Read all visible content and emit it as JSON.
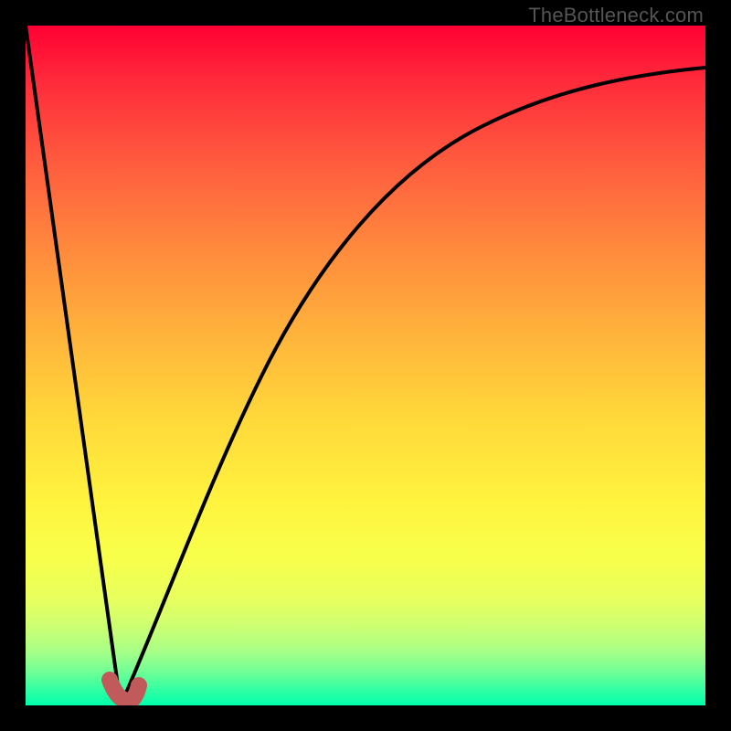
{
  "watermark": "TheBottleneck.com",
  "chart_data": {
    "type": "line",
    "title": "",
    "xlabel": "",
    "ylabel": "",
    "xlim": [
      0,
      100
    ],
    "ylim": [
      0,
      100
    ],
    "grid": false,
    "series": [
      {
        "name": "falling-segment",
        "x": [
          0,
          14
        ],
        "y": [
          100,
          0
        ]
      },
      {
        "name": "rising-curve",
        "x": [
          14,
          18,
          22,
          26,
          30,
          35,
          40,
          46,
          53,
          60,
          68,
          77,
          87,
          100
        ],
        "y": [
          0,
          12,
          23,
          33,
          42,
          52,
          60,
          67,
          74,
          79,
          84,
          88,
          91,
          94
        ]
      },
      {
        "name": "marker",
        "x": [
          12.5,
          13.5,
          14.5,
          15.3,
          16
        ],
        "y": [
          3.5,
          1.2,
          0.6,
          1.4,
          2.8
        ]
      }
    ],
    "annotations": [],
    "colors": {
      "curve": "#000000",
      "marker": "#c15a5a",
      "gradient_top": "#ff0033",
      "gradient_bottom": "#00ffab",
      "frame": "#000000"
    }
  }
}
